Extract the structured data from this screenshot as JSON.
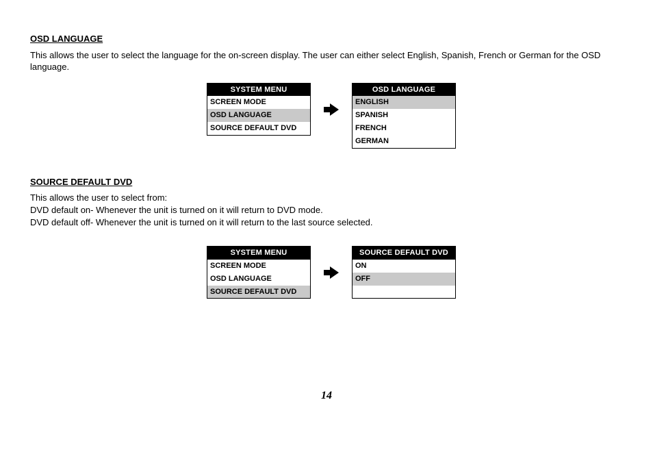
{
  "section1": {
    "heading": "OSD LANGUAGE",
    "body": "This allows the user to select the language for the on-screen display. The user can either select English, Spanish, French or German for the OSD language.",
    "menu_left": {
      "title": "SYSTEM MENU",
      "items": [
        "SCREEN MODE",
        "OSD LANGUAGE",
        "SOURCE DEFAULT DVD"
      ],
      "selected_index": 1
    },
    "menu_right": {
      "title": "OSD LANGUAGE",
      "items": [
        "ENGLISH",
        "SPANISH",
        "FRENCH",
        "GERMAN"
      ],
      "selected_index": 0
    }
  },
  "section2": {
    "heading": "SOURCE DEFAULT DVD",
    "line1": "This allows the user to select from:",
    "line2": "DVD default on-  Whenever the unit is turned on it will return to DVD mode.",
    "line3": "DVD default off-  Whenever the unit is turned on it will return to the last source selected.",
    "menu_left": {
      "title": "SYSTEM MENU",
      "items": [
        "SCREEN MODE",
        "OSD LANGUAGE",
        "SOURCE DEFAULT DVD"
      ],
      "selected_index": 2
    },
    "menu_right": {
      "title": "SOURCE DEFAULT DVD",
      "items": [
        "ON",
        "OFF",
        ""
      ],
      "selected_index": 1
    }
  },
  "page_number": "14"
}
